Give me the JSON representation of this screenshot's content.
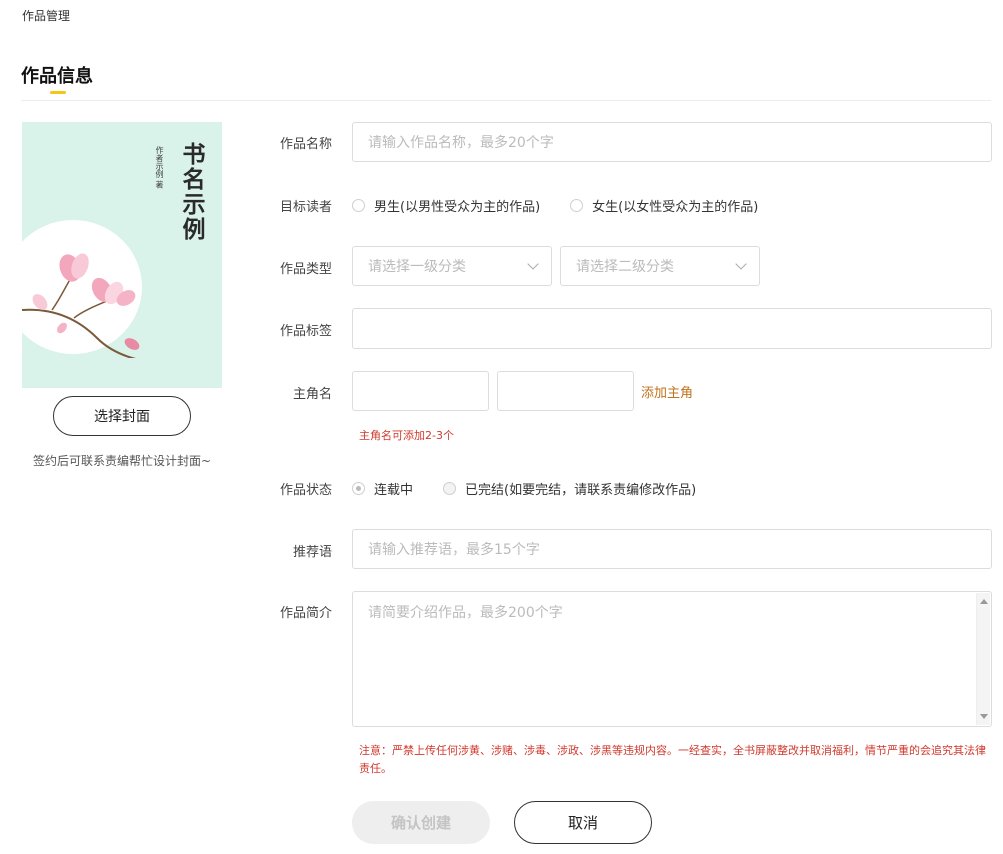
{
  "breadcrumb": "作品管理",
  "section_title": "作品信息",
  "colors": {
    "accent": "#f5c518",
    "warning": "#d0392e",
    "link": "#c2711c",
    "cover_bg": "#d9f2ea"
  },
  "cover": {
    "title": "书名示例",
    "author": "作者示例 著",
    "choose_button": "选择封面",
    "hint": "签约后可联系责编帮忙设计封面~"
  },
  "form": {
    "name": {
      "label": "作品名称",
      "placeholder": "请输入作品名称，最多20个字"
    },
    "audience": {
      "label": "目标读者",
      "options": [
        "男生(以男性受众为主的作品)",
        "女生(以女性受众为主的作品)"
      ]
    },
    "type": {
      "label": "作品类型",
      "primary": "请选择一级分类",
      "secondary": "请选择二级分类"
    },
    "tags": {
      "label": "作品标签",
      "placeholder": ""
    },
    "protagonist": {
      "label": "主角名",
      "add_link": "添加主角",
      "hint": "主角名可添加2-3个"
    },
    "status": {
      "label": "作品状态",
      "options": [
        "连载中",
        "已完结(如要完结，请联系责编修改作品)"
      ]
    },
    "slogan": {
      "label": "推荐语",
      "placeholder": "请输入推荐语，最多15个字"
    },
    "intro": {
      "label": "作品简介",
      "placeholder": "请简要介绍作品，最多200个字"
    },
    "notice": "注意：严禁上传任何涉黄、涉赌、涉毒、涉政、涉黑等违规内容。一经查实，全书屏蔽整改并取消福利，情节严重的会追究其法律责任。"
  },
  "buttons": {
    "confirm": "确认创建",
    "cancel": "取消"
  }
}
